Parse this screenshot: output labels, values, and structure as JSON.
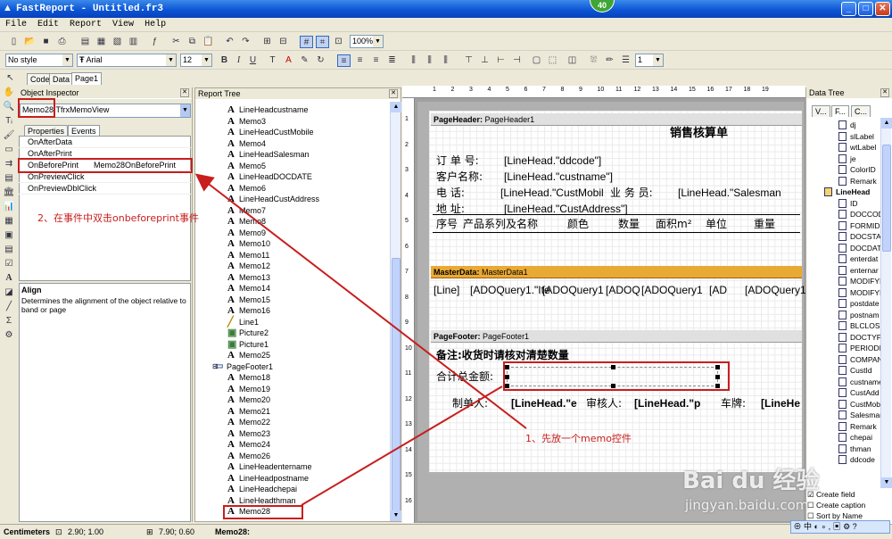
{
  "window": {
    "title": "FastReport - Untitled.fr3",
    "notification_badge": "40",
    "buttons": {
      "minimize": "_",
      "maximize": "□",
      "close": "✕"
    }
  },
  "menu": [
    "File",
    "Edit",
    "Report",
    "View",
    "Help"
  ],
  "toolbar": {
    "zoom": "100%",
    "style": "No style",
    "font": "Arial",
    "font_size": "12",
    "frame_width": "1",
    "bold": "B",
    "italic": "I",
    "underline": "U"
  },
  "tabs": [
    "Code",
    "Data",
    "Page1"
  ],
  "object_inspector": {
    "title": "Object Inspector",
    "selected_object": "Memo28:",
    "selected_type": "TfrxMemoView",
    "subtabs": [
      "Properties",
      "Events"
    ],
    "events": [
      {
        "name": "OnAfterData",
        "value": ""
      },
      {
        "name": "OnAfterPrint",
        "value": ""
      },
      {
        "name": "OnBeforePrint",
        "value": "Memo28OnBeforePrint"
      },
      {
        "name": "OnPreviewClick",
        "value": ""
      },
      {
        "name": "OnPreviewDblClick",
        "value": ""
      }
    ],
    "help_title": "Align",
    "help_text": "Determines the alignment of the object relative to band or page"
  },
  "report_tree": {
    "title": "Report Tree",
    "items": [
      "LineHeadcustname",
      "Memo3",
      "LineHeadCustMobile",
      "Memo4",
      "LineHeadSalesman",
      "Memo5",
      "LineHeadDOCDATE",
      "Memo6",
      "LineHeadCustAddress",
      "Memo7",
      "Memo8",
      "Memo9",
      "Memo10",
      "Memo11",
      "Memo12",
      "Memo13",
      "Memo14",
      "Memo15",
      "Memo16",
      "Line1",
      "Picture2",
      "Picture1",
      "Memo25"
    ],
    "footer_band": "PageFooter1",
    "footer_items": [
      "Memo18",
      "Memo19",
      "Memo20",
      "Memo21",
      "Memo22",
      "Memo23",
      "Memo24",
      "Memo26",
      "LineHeadentername",
      "LineHeadpostname",
      "LineHeadchepai",
      "LineHeadthman",
      "Memo28"
    ]
  },
  "ruler": {
    "ticks": [
      "1",
      "2",
      "3",
      "4",
      "5",
      "6",
      "7",
      "8",
      "9",
      "10",
      "11",
      "12",
      "13",
      "14",
      "15",
      "16",
      "17",
      "18",
      "19"
    ]
  },
  "ruler_v": [
    "1",
    "2",
    "3",
    "4",
    "5",
    "6",
    "7",
    "8",
    "9",
    "10",
    "11",
    "12",
    "13",
    "14",
    "15",
    "16"
  ],
  "page": {
    "page_header": {
      "title": "PageHeader:",
      "name": "PageHeader1",
      "heading": "销售核算单",
      "rows": [
        {
          "label": "订 单 号:",
          "field": "[LineHead.\"ddcode\"]"
        },
        {
          "label": "客户名称:",
          "field": "[LineHead.\"custname\"]"
        },
        {
          "label": "电    话:",
          "field": "[LineHead.\"CustMobil",
          "label2": "业 务 员:",
          "field2": "[LineHead.\"Salesman"
        },
        {
          "label": "地    址:",
          "field": "[LineHead.\"CustAddress\"]"
        }
      ],
      "columns": [
        "序号",
        "产品系列及名称",
        "颜色",
        "数量",
        "面积m²",
        "单位",
        "重量"
      ]
    },
    "master_data": {
      "title": "MasterData:",
      "name": "MasterData1",
      "fields": [
        "[Line]",
        "[ADOQuery1.\"Ite",
        "[ADOQuery1",
        "[ADOQ",
        "[ADOQuery1",
        "[AD",
        "[ADOQuery1"
      ]
    },
    "page_footer": {
      "title": "PageFooter:",
      "name": "PageFooter1",
      "note": "备注:收货时请核对清楚数量",
      "total_label": "合计总金额:",
      "makers": [
        "制单人:",
        "[LineHead.\"e",
        "审核人:",
        "[LineHead.\"p",
        "车牌:",
        "[LineHe"
      ]
    }
  },
  "data_tree": {
    "title": "Data Tree",
    "tabs": [
      "V...",
      "F...",
      "C..."
    ],
    "items_top": [
      "dj",
      "slLabel",
      "wtLabel",
      "je",
      "ColorID",
      "Remark"
    ],
    "group": "LineHead",
    "items": [
      "ID",
      "DOCCOD",
      "FORMID",
      "DOCSTA",
      "DOCDAT",
      "enterdat",
      "enternar",
      "MODIFYI",
      "MODIFYI",
      "postdate",
      "postnam",
      "BLCLOSE",
      "DOCTYPI",
      "PERIODI",
      "COMPAN",
      "CustId",
      "custname",
      "CustAdd",
      "CustMob",
      "Salesmar",
      "Remark",
      "chepai",
      "thman",
      "ddcode"
    ],
    "create_field": "Create field",
    "create_caption": "Create caption",
    "sort_by_name": "Sort by Name"
  },
  "status": {
    "units": "Centimeters",
    "pos": "2.90; 1.00",
    "size": "7.90; 0.60",
    "object": "Memo28:"
  },
  "annotations": {
    "step1": "1、先放一个memo控件",
    "step2": "2、在事件中双击onbeforeprint事件"
  },
  "watermark": {
    "brand": "Bai du 经验",
    "url": "jingyan.baidu.com"
  }
}
